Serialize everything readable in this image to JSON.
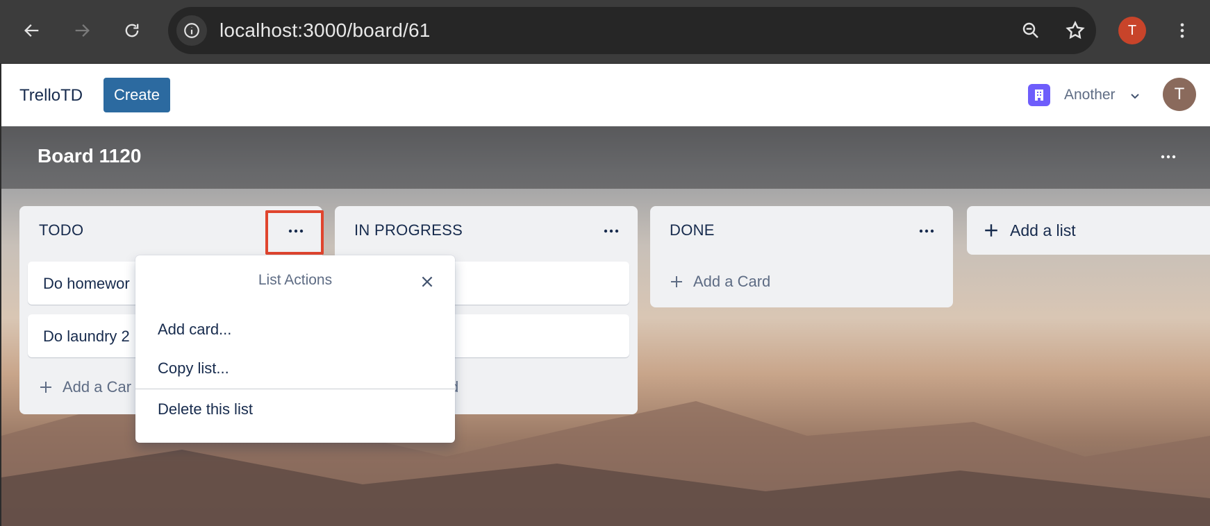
{
  "browser": {
    "url": "localhost:3000/board/61",
    "profile_initial": "T"
  },
  "app": {
    "brand": "TrelloTD",
    "create_label": "Create",
    "workspace_name": "Another",
    "user_initial": "T"
  },
  "board": {
    "title": "Board 1120",
    "lists": [
      {
        "title": "TODO",
        "cards": [
          "Do homewor",
          "Do laundry 2"
        ],
        "add_card_label": "Add a Car"
      },
      {
        "title": "IN PROGRESS",
        "cards": [
          "",
          ""
        ],
        "add_card_label": "d"
      },
      {
        "title": "DONE",
        "cards": [],
        "add_card_label": "Add a Card"
      }
    ],
    "add_list_label": "Add a list"
  },
  "popover": {
    "title": "List Actions",
    "items": [
      "Add card...",
      "Copy list...",
      "Delete this list"
    ]
  },
  "colors": {
    "create_button": "#2c6aa0",
    "highlight": "#e0452e",
    "profile_chip": "#c8442a",
    "workspace_icon": "#6e5dfb"
  }
}
